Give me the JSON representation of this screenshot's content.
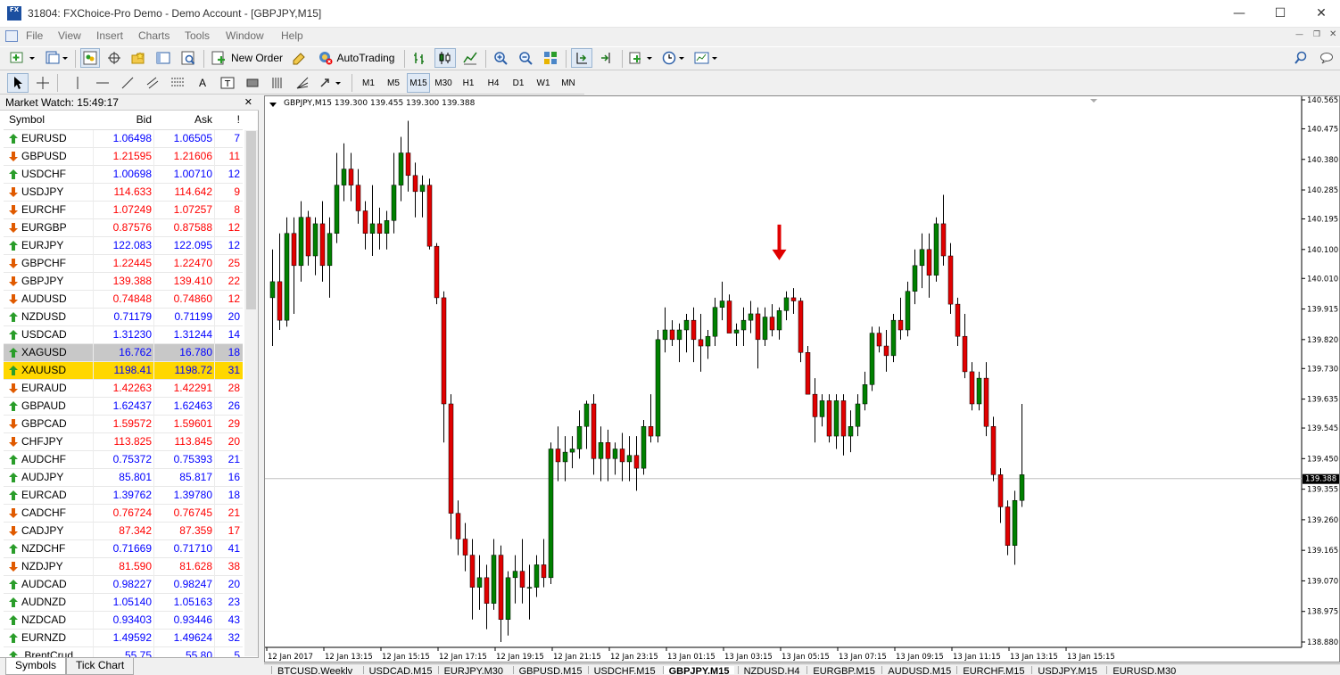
{
  "window": {
    "title": "31804: FXChoice-Pro Demo - Demo Account - [GBPJPY,M15]",
    "app_icon_text": "FX"
  },
  "menu": [
    "File",
    "View",
    "Insert",
    "Charts",
    "Tools",
    "Window",
    "Help"
  ],
  "toolbar": {
    "new_order_label": "New Order",
    "autotrading_label": "AutoTrading",
    "timeframes": [
      "M1",
      "M5",
      "M15",
      "M30",
      "H1",
      "H4",
      "D1",
      "W1",
      "MN"
    ],
    "active_timeframe": "M15"
  },
  "market_watch": {
    "title": "Market Watch: 15:49:17",
    "columns": {
      "symbol": "Symbol",
      "bid": "Bid",
      "ask": "Ask",
      "spread": "!"
    },
    "rows": [
      {
        "symbol": "EURUSD",
        "bid": "1.06498",
        "ask": "1.06505",
        "spread": "7",
        "dir": "up"
      },
      {
        "symbol": "GBPUSD",
        "bid": "1.21595",
        "ask": "1.21606",
        "spread": "11",
        "dir": "down"
      },
      {
        "symbol": "USDCHF",
        "bid": "1.00698",
        "ask": "1.00710",
        "spread": "12",
        "dir": "up"
      },
      {
        "symbol": "USDJPY",
        "bid": "114.633",
        "ask": "114.642",
        "spread": "9",
        "dir": "down"
      },
      {
        "symbol": "EURCHF",
        "bid": "1.07249",
        "ask": "1.07257",
        "spread": "8",
        "dir": "down"
      },
      {
        "symbol": "EURGBP",
        "bid": "0.87576",
        "ask": "0.87588",
        "spread": "12",
        "dir": "down"
      },
      {
        "symbol": "EURJPY",
        "bid": "122.083",
        "ask": "122.095",
        "spread": "12",
        "dir": "up"
      },
      {
        "symbol": "GBPCHF",
        "bid": "1.22445",
        "ask": "1.22470",
        "spread": "25",
        "dir": "down"
      },
      {
        "symbol": "GBPJPY",
        "bid": "139.388",
        "ask": "139.410",
        "spread": "22",
        "dir": "down"
      },
      {
        "symbol": "AUDUSD",
        "bid": "0.74848",
        "ask": "0.74860",
        "spread": "12",
        "dir": "down"
      },
      {
        "symbol": "NZDUSD",
        "bid": "0.71179",
        "ask": "0.71199",
        "spread": "20",
        "dir": "up"
      },
      {
        "symbol": "USDCAD",
        "bid": "1.31230",
        "ask": "1.31244",
        "spread": "14",
        "dir": "up"
      },
      {
        "symbol": "XAGUSD",
        "bid": "16.762",
        "ask": "16.780",
        "spread": "18",
        "dir": "up",
        "highlight": "gray"
      },
      {
        "symbol": "XAUUSD",
        "bid": "1198.41",
        "ask": "1198.72",
        "spread": "31",
        "dir": "up",
        "highlight": "gold"
      },
      {
        "symbol": "EURAUD",
        "bid": "1.42263",
        "ask": "1.42291",
        "spread": "28",
        "dir": "down"
      },
      {
        "symbol": "GBPAUD",
        "bid": "1.62437",
        "ask": "1.62463",
        "spread": "26",
        "dir": "up"
      },
      {
        "symbol": "GBPCAD",
        "bid": "1.59572",
        "ask": "1.59601",
        "spread": "29",
        "dir": "down"
      },
      {
        "symbol": "CHFJPY",
        "bid": "113.825",
        "ask": "113.845",
        "spread": "20",
        "dir": "down"
      },
      {
        "symbol": "AUDCHF",
        "bid": "0.75372",
        "ask": "0.75393",
        "spread": "21",
        "dir": "up"
      },
      {
        "symbol": "AUDJPY",
        "bid": "85.801",
        "ask": "85.817",
        "spread": "16",
        "dir": "up"
      },
      {
        "symbol": "EURCAD",
        "bid": "1.39762",
        "ask": "1.39780",
        "spread": "18",
        "dir": "up"
      },
      {
        "symbol": "CADCHF",
        "bid": "0.76724",
        "ask": "0.76745",
        "spread": "21",
        "dir": "down"
      },
      {
        "symbol": "CADJPY",
        "bid": "87.342",
        "ask": "87.359",
        "spread": "17",
        "dir": "down"
      },
      {
        "symbol": "NZDCHF",
        "bid": "0.71669",
        "ask": "0.71710",
        "spread": "41",
        "dir": "up"
      },
      {
        "symbol": "NZDJPY",
        "bid": "81.590",
        "ask": "81.628",
        "spread": "38",
        "dir": "down"
      },
      {
        "symbol": "AUDCAD",
        "bid": "0.98227",
        "ask": "0.98247",
        "spread": "20",
        "dir": "up"
      },
      {
        "symbol": "AUDNZD",
        "bid": "1.05140",
        "ask": "1.05163",
        "spread": "23",
        "dir": "up"
      },
      {
        "symbol": "NZDCAD",
        "bid": "0.93403",
        "ask": "0.93446",
        "spread": "43",
        "dir": "up"
      },
      {
        "symbol": "EURNZD",
        "bid": "1.49592",
        "ask": "1.49624",
        "spread": "32",
        "dir": "up"
      },
      {
        "symbol": ".BrentCrud",
        "bid": "55.75",
        "ask": "55.80",
        "spread": "5",
        "dir": "up"
      }
    ],
    "tabs": [
      "Symbols",
      "Tick Chart"
    ],
    "active_tab": "Symbols"
  },
  "chart": {
    "header": "GBPJPY,M15  139.300 139.455 139.300 139.388",
    "current_price_label": "139.388",
    "tabs": [
      "BTCUSD,Weekly",
      "USDCAD,M15",
      "EURJPY,M30",
      "GBPUSD,M15",
      "USDCHF,M15",
      "GBPJPY,M15",
      "NZDUSD,H4",
      "EURGBP,M15",
      "AUDUSD,M15",
      "EURCHF,M15",
      "USDJPY,M15",
      "EURUSD,M30"
    ],
    "active_tab": "GBPJPY,M15"
  },
  "colors": {
    "bull": "#008000",
    "bear": "#e00000",
    "bid_up": "#0000ff",
    "bid_down": "#ff0000",
    "highlight_gold": "#ffd700",
    "highlight_gray": "#c8c8c8",
    "arrow": "#e00000"
  },
  "chart_data": {
    "type": "candlestick",
    "title": "GBPJPY,M15",
    "y_ticks": [
      "140.565",
      "140.475",
      "140.380",
      "140.285",
      "140.195",
      "140.100",
      "140.010",
      "139.915",
      "139.820",
      "139.730",
      "139.635",
      "139.545",
      "139.450",
      "139.355",
      "139.260",
      "139.165",
      "139.070",
      "138.975",
      "138.880"
    ],
    "ylim": [
      138.88,
      140.565
    ],
    "x_ticks": [
      "12 Jan 2017",
      "12 Jan 13:15",
      "12 Jan 15:15",
      "12 Jan 17:15",
      "12 Jan 19:15",
      "12 Jan 21:15",
      "12 Jan 23:15",
      "13 Jan 01:15",
      "13 Jan 03:15",
      "13 Jan 05:15",
      "13 Jan 07:15",
      "13 Jan 09:15",
      "13 Jan 11:15",
      "13 Jan 13:15",
      "13 Jan 15:15"
    ],
    "current_price": 139.388,
    "annotation": {
      "type": "down-arrow",
      "at_price": 140.05
    },
    "candles": [
      [
        139.95,
        140.1,
        139.8,
        140.0
      ],
      [
        140.0,
        140.15,
        139.85,
        139.88
      ],
      [
        139.88,
        140.2,
        139.86,
        140.15
      ],
      [
        140.15,
        140.2,
        139.9,
        140.05
      ],
      [
        140.05,
        140.25,
        140.0,
        140.2
      ],
      [
        140.2,
        140.22,
        140.05,
        140.08
      ],
      [
        140.08,
        140.2,
        140.02,
        140.18
      ],
      [
        140.18,
        140.25,
        140.0,
        140.05
      ],
      [
        140.05,
        140.2,
        139.95,
        140.15
      ],
      [
        140.15,
        140.4,
        140.12,
        140.3
      ],
      [
        140.3,
        140.43,
        140.25,
        140.35
      ],
      [
        140.35,
        140.4,
        140.25,
        140.3
      ],
      [
        140.3,
        140.35,
        140.18,
        140.22
      ],
      [
        140.22,
        140.25,
        140.1,
        140.15
      ],
      [
        140.15,
        140.3,
        140.08,
        140.18
      ],
      [
        140.18,
        140.23,
        140.1,
        140.15
      ],
      [
        140.15,
        140.22,
        140.1,
        140.19
      ],
      [
        140.19,
        140.4,
        140.15,
        140.3
      ],
      [
        140.3,
        140.45,
        140.25,
        140.4
      ],
      [
        140.4,
        140.5,
        140.28,
        140.33
      ],
      [
        140.33,
        140.37,
        140.2,
        140.28
      ],
      [
        140.28,
        140.33,
        140.2,
        140.3
      ],
      [
        140.3,
        140.32,
        140.1,
        140.11
      ],
      [
        140.11,
        140.12,
        139.93,
        139.95
      ],
      [
        139.95,
        139.97,
        139.5,
        139.62
      ],
      [
        139.62,
        139.65,
        139.2,
        139.28
      ],
      [
        139.28,
        139.32,
        139.15,
        139.2
      ],
      [
        139.2,
        139.25,
        139.1,
        139.15
      ],
      [
        139.15,
        139.2,
        138.95,
        139.05
      ],
      [
        139.05,
        139.15,
        138.98,
        139.08
      ],
      [
        139.08,
        139.12,
        138.92,
        139.0
      ],
      [
        139.0,
        139.2,
        138.98,
        139.15
      ],
      [
        139.15,
        139.18,
        138.88,
        138.95
      ],
      [
        138.95,
        139.1,
        138.9,
        139.08
      ],
      [
        139.08,
        139.15,
        139.0,
        139.1
      ],
      [
        139.1,
        139.2,
        139.0,
        139.05
      ],
      [
        139.05,
        139.12,
        138.95,
        139.05
      ],
      [
        139.05,
        139.15,
        139.02,
        139.12
      ],
      [
        139.12,
        139.2,
        139.05,
        139.08
      ],
      [
        139.08,
        139.5,
        139.06,
        139.48
      ],
      [
        139.48,
        139.55,
        139.38,
        139.44
      ],
      [
        139.44,
        139.52,
        139.38,
        139.47
      ],
      [
        139.47,
        139.52,
        139.42,
        139.48
      ],
      [
        139.48,
        139.6,
        139.45,
        139.55
      ],
      [
        139.55,
        139.63,
        139.48,
        139.62
      ],
      [
        139.62,
        139.65,
        139.4,
        139.45
      ],
      [
        139.45,
        139.55,
        139.38,
        139.5
      ],
      [
        139.5,
        139.54,
        139.38,
        139.45
      ],
      [
        139.45,
        139.5,
        139.4,
        139.48
      ],
      [
        139.48,
        139.53,
        139.38,
        139.44
      ],
      [
        139.44,
        139.52,
        139.38,
        139.46
      ],
      [
        139.46,
        139.52,
        139.35,
        139.42
      ],
      [
        139.42,
        139.57,
        139.4,
        139.55
      ],
      [
        139.55,
        139.65,
        139.5,
        139.52
      ],
      [
        139.52,
        139.85,
        139.5,
        139.82
      ],
      [
        139.82,
        139.92,
        139.78,
        139.85
      ],
      [
        139.85,
        139.88,
        139.8,
        139.82
      ],
      [
        139.82,
        139.87,
        139.75,
        139.85
      ],
      [
        139.85,
        139.9,
        139.78,
        139.88
      ],
      [
        139.88,
        139.92,
        139.75,
        139.82
      ],
      [
        139.82,
        139.9,
        139.72,
        139.8
      ],
      [
        139.8,
        139.85,
        139.76,
        139.83
      ],
      [
        139.83,
        139.95,
        139.8,
        139.92
      ],
      [
        139.92,
        140.0,
        139.88,
        139.94
      ],
      [
        139.94,
        139.96,
        139.84,
        139.84
      ],
      [
        139.84,
        139.87,
        139.8,
        139.85
      ],
      [
        139.85,
        139.92,
        139.8,
        139.88
      ],
      [
        139.88,
        139.94,
        139.84,
        139.9
      ],
      [
        139.9,
        139.92,
        139.73,
        139.82
      ],
      [
        139.82,
        139.92,
        139.8,
        139.89
      ],
      [
        139.89,
        139.93,
        139.83,
        139.85
      ],
      [
        139.85,
        139.92,
        139.82,
        139.91
      ],
      [
        139.91,
        139.97,
        139.88,
        139.95
      ],
      [
        139.95,
        139.98,
        139.9,
        139.94
      ],
      [
        139.94,
        139.95,
        139.75,
        139.78
      ],
      [
        139.78,
        139.8,
        139.65,
        139.65
      ],
      [
        139.65,
        139.7,
        139.5,
        139.58
      ],
      [
        139.58,
        139.65,
        139.55,
        139.63
      ],
      [
        139.63,
        139.65,
        139.5,
        139.52
      ],
      [
        139.52,
        139.65,
        139.48,
        139.63
      ],
      [
        139.63,
        139.65,
        139.46,
        139.52
      ],
      [
        139.52,
        139.6,
        139.47,
        139.55
      ],
      [
        139.55,
        139.65,
        139.52,
        139.62
      ],
      [
        139.62,
        139.72,
        139.6,
        139.68
      ],
      [
        139.68,
        139.86,
        139.66,
        139.84
      ],
      [
        139.84,
        139.86,
        139.78,
        139.8
      ],
      [
        139.8,
        139.85,
        139.72,
        139.77
      ],
      [
        139.77,
        139.9,
        139.75,
        139.88
      ],
      [
        139.88,
        139.95,
        139.82,
        139.85
      ],
      [
        139.85,
        140.0,
        139.83,
        139.97
      ],
      [
        139.97,
        140.1,
        139.93,
        140.05
      ],
      [
        140.05,
        140.15,
        139.98,
        140.1
      ],
      [
        140.1,
        140.15,
        139.95,
        140.02
      ],
      [
        140.02,
        140.2,
        140.0,
        140.18
      ],
      [
        140.18,
        140.27,
        140.05,
        140.08
      ],
      [
        140.08,
        140.12,
        139.9,
        139.93
      ],
      [
        139.93,
        139.95,
        139.8,
        139.83
      ],
      [
        139.83,
        139.9,
        139.7,
        139.72
      ],
      [
        139.72,
        139.75,
        139.6,
        139.62
      ],
      [
        139.62,
        139.72,
        139.6,
        139.7
      ],
      [
        139.7,
        139.75,
        139.52,
        139.55
      ],
      [
        139.55,
        139.58,
        139.38,
        139.4
      ],
      [
        139.4,
        139.42,
        139.25,
        139.3
      ],
      [
        139.3,
        139.32,
        139.15,
        139.18
      ],
      [
        139.18,
        139.35,
        139.12,
        139.32
      ],
      [
        139.32,
        139.62,
        139.3,
        139.4
      ]
    ]
  }
}
